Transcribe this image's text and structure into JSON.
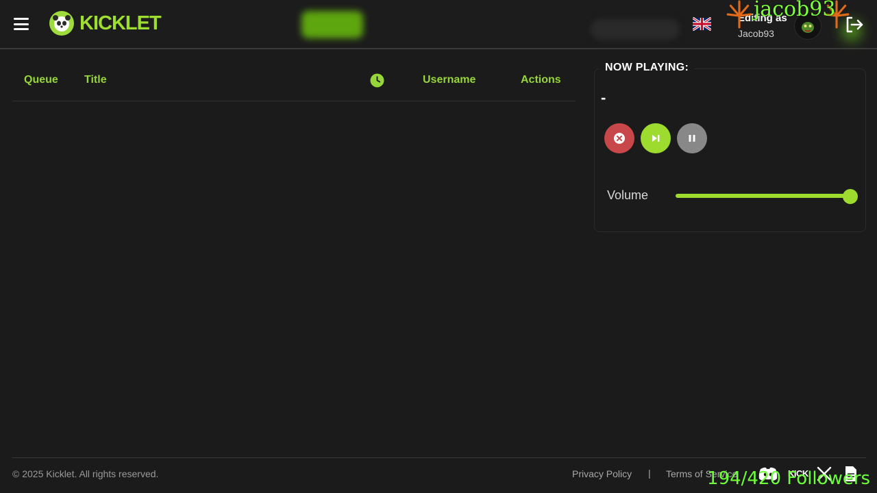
{
  "header": {
    "brand": "KICKLET",
    "editing_label": "Editing as",
    "editing_user": "Jacob93"
  },
  "overlay": {
    "streamer_name": "jacob93",
    "followers": "194/420 Followers"
  },
  "queue": {
    "columns": {
      "queue": "Queue",
      "title": "Title",
      "duration_icon": "clock-icon",
      "username": "Username",
      "actions": "Actions"
    },
    "rows": []
  },
  "now_playing": {
    "heading": "NOW PLAYING:",
    "track": "-",
    "volume_label": "Volume",
    "volume_percent": 100
  },
  "footer": {
    "copyright": "© 2025 Kicklet. All rights reserved.",
    "privacy": "Privacy Policy",
    "separator": "|",
    "terms": "Terms of Service",
    "kick": "KICK"
  },
  "colors": {
    "accent": "#9edb2f",
    "stop": "#c8474a",
    "pause": "#888888",
    "background": "#1b1b1b"
  }
}
